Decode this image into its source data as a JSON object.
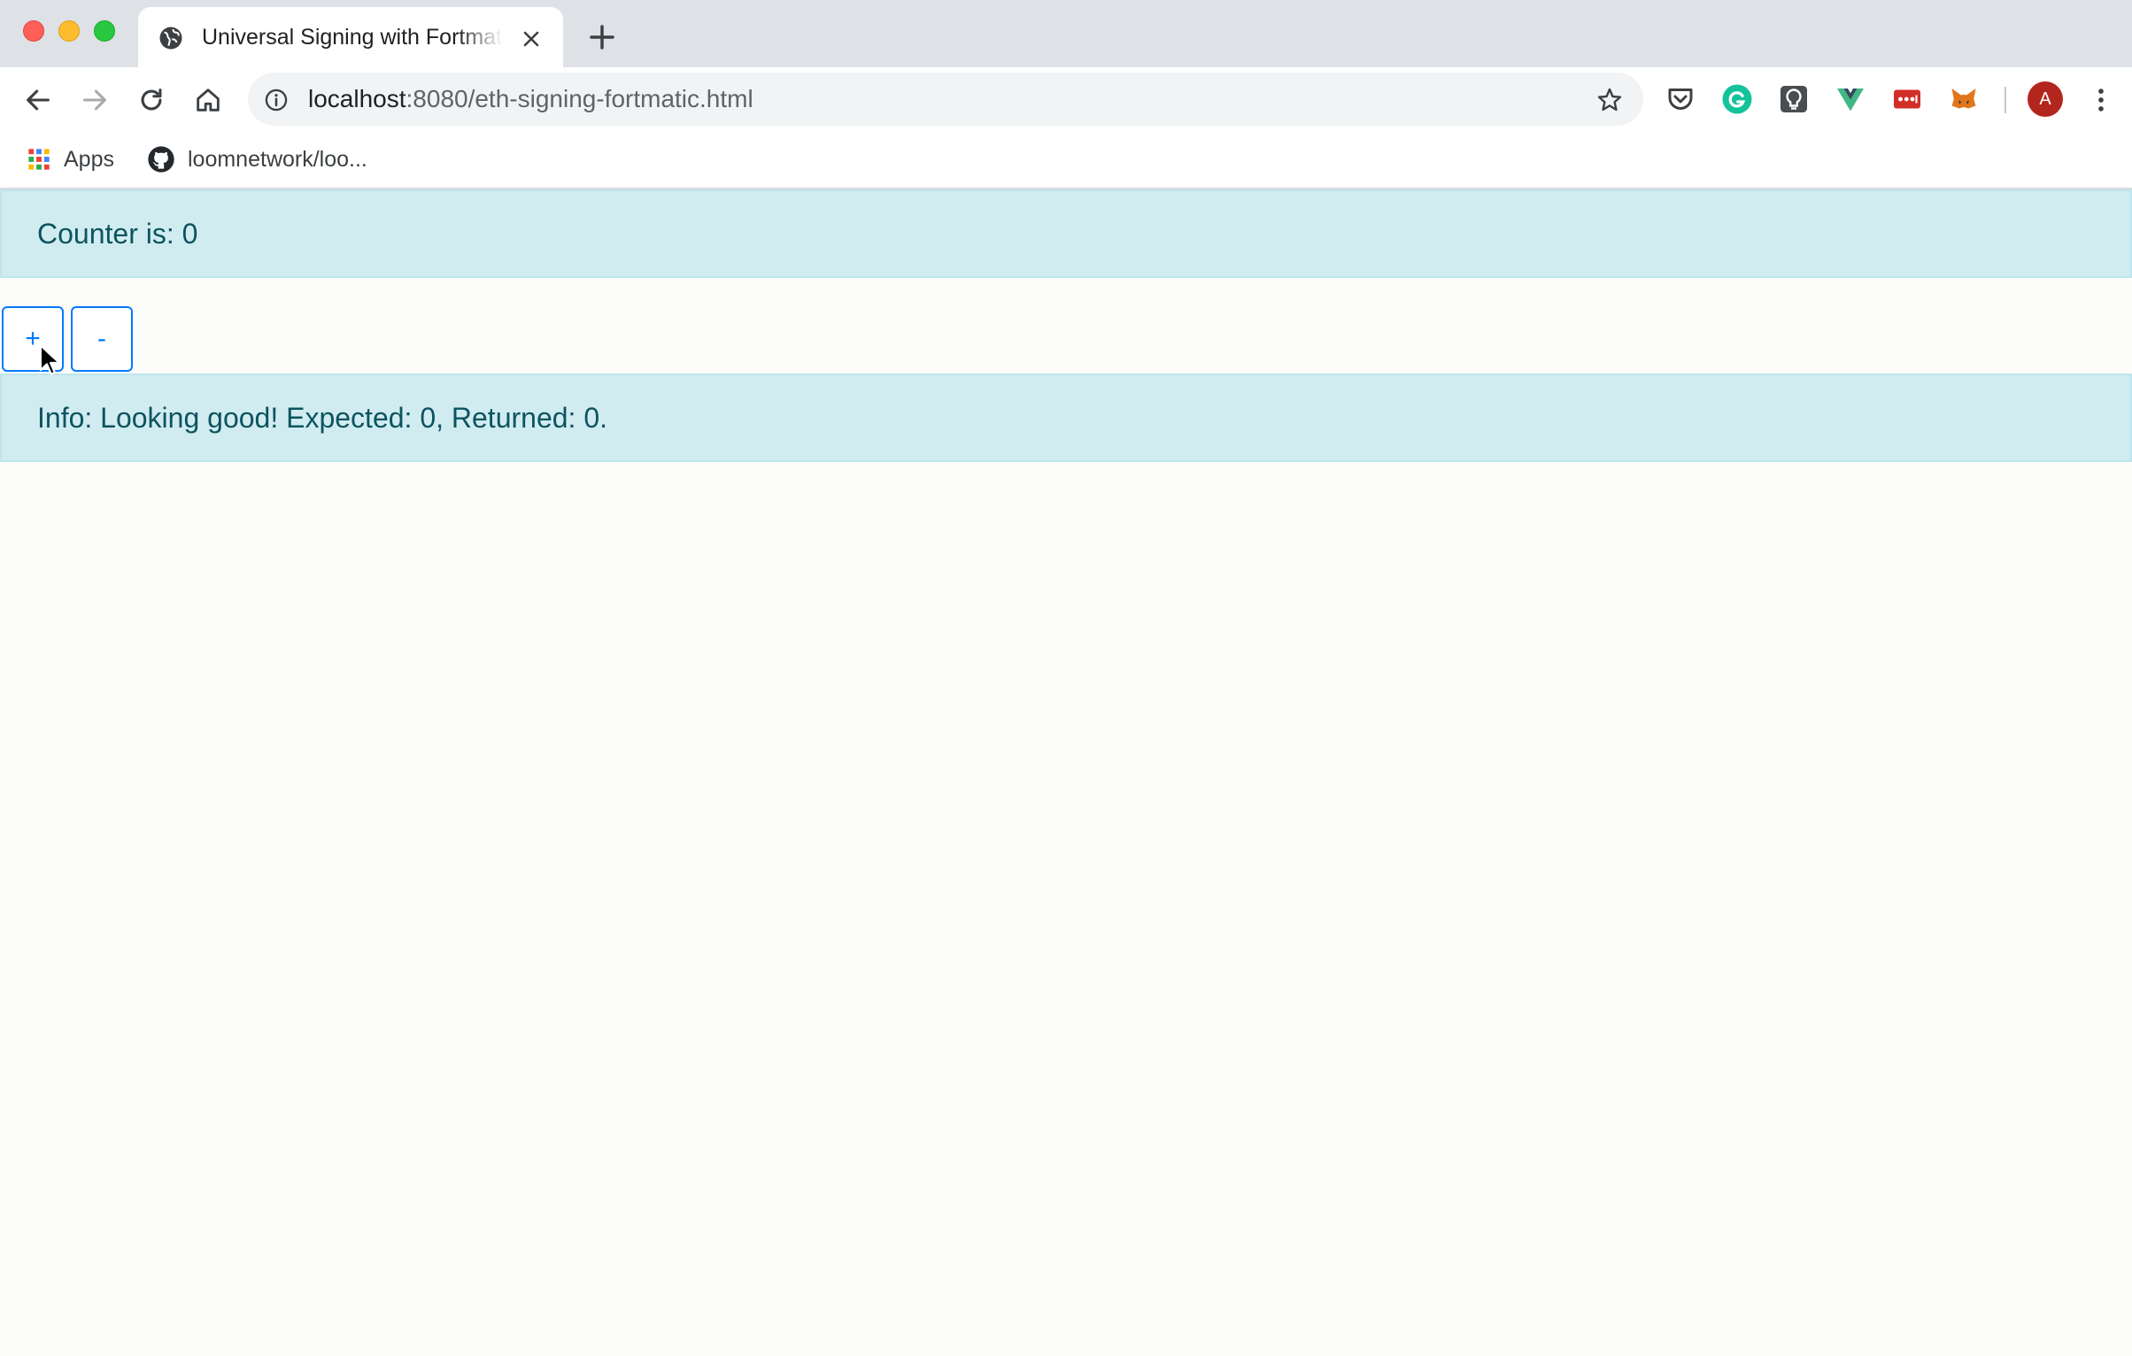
{
  "browser": {
    "tab": {
      "title": "Universal Signing with Fortmatic",
      "favicon": "globe-icon"
    },
    "address_bar": {
      "host": "localhost",
      "path": ":8080/eth-signing-fortmatic.html"
    },
    "profile_initial": "A",
    "bookmarks": [
      {
        "label": "Apps",
        "icon": "apps-grid-icon"
      },
      {
        "label": "loomnetwork/loo...",
        "icon": "github-icon"
      }
    ],
    "extensions": [
      "pocket-icon",
      "grammarly-icon",
      "lightbulb-icon",
      "vue-devtools-icon",
      "lastpass-icon",
      "metamask-icon"
    ]
  },
  "page": {
    "counter_text": "Counter is: 0",
    "increment_label": "+",
    "decrement_label": "-",
    "info_text": "Info: Looking good! Expected: 0, Returned: 0."
  },
  "colors": {
    "alert_bg": "#d1ecf1",
    "alert_text": "#0c5460",
    "primary": "#007bff"
  }
}
